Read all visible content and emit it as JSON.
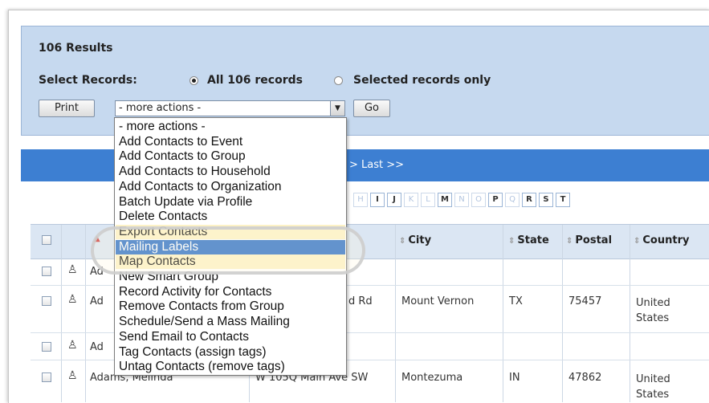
{
  "results": {
    "title": "106 Results",
    "select_label": "Select Records:",
    "all_label": "All 106 records",
    "selected_label": "Selected records only",
    "all_checked": true
  },
  "toolbar": {
    "print_label": "Print",
    "actions_value": "- more actions -",
    "go_label": "Go"
  },
  "actions_menu": {
    "options": [
      "- more actions -",
      "Add Contacts to Event",
      "Add Contacts to Group",
      "Add Contacts to Household",
      "Add Contacts to Organization",
      "Batch Update via Profile",
      "Delete Contacts",
      "Export Contacts",
      "Mailing Labels",
      "Map Contacts",
      "New Smart Group",
      "Record Activity for Contacts",
      "Remove Contacts from Group",
      "Schedule/Send a Mass Mailing",
      "Send Email to Contacts",
      "Tag Contacts (assign tags)",
      "Untag Contacts (remove tags)"
    ],
    "highlighted": "Mailing Labels"
  },
  "pager": {
    "text": "> Last >>"
  },
  "alphabet": [
    "H",
    "I",
    "J",
    "K",
    "L",
    "M",
    "N",
    "O",
    "P",
    "Q",
    "R",
    "S",
    "T"
  ],
  "alphabet_enabled": [
    "I",
    "J",
    "M",
    "P",
    "R",
    "S",
    "T"
  ],
  "table": {
    "headers": [
      "City",
      "State",
      "Postal",
      "Country"
    ],
    "rows": [
      {
        "name": "Ad",
        "address": "",
        "city": "",
        "state": "",
        "postal": "",
        "country": ""
      },
      {
        "name": "Ad",
        "address": "d Rd",
        "city": "Mount Vernon",
        "state": "TX",
        "postal": "75457",
        "country": "United States"
      },
      {
        "name": "Ad",
        "address": "",
        "city": "",
        "state": "",
        "postal": "",
        "country": ""
      },
      {
        "name": "Adams, Melinda",
        "address": "W 105Q Main Ave SW",
        "city": "Montezuma",
        "state": "IN",
        "postal": "47862",
        "country": "United States"
      }
    ]
  }
}
